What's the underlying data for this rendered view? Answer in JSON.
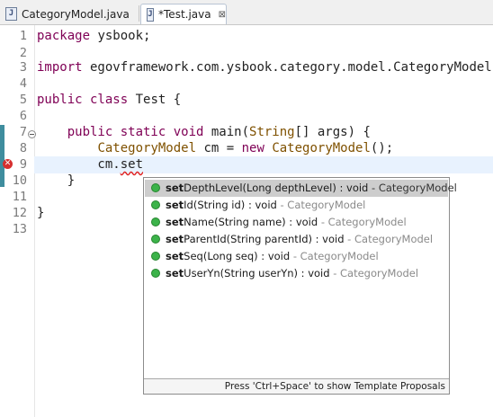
{
  "tabs": [
    {
      "label": "CategoryModel.java",
      "icon": "java-file-icon"
    },
    {
      "label": "*Test.java",
      "icon": "java-file-icon",
      "close": "⊠"
    }
  ],
  "editor": {
    "lines": [
      {
        "n": "1",
        "code": "package ysbook;"
      },
      {
        "n": "2",
        "code": ""
      },
      {
        "n": "3",
        "code": "import egovframework.com.ysbook.category.model.CategoryModel;"
      },
      {
        "n": "4",
        "code": ""
      },
      {
        "n": "5",
        "code": "public class Test {"
      },
      {
        "n": "6",
        "code": ""
      },
      {
        "n": "7",
        "code": "    public static void main(String[] args) {"
      },
      {
        "n": "8",
        "code": "        CategoryModel cm = new CategoryModel();"
      },
      {
        "n": "9",
        "code": "        cm.set"
      },
      {
        "n": "10",
        "code": "    }"
      },
      {
        "n": "11",
        "code": ""
      },
      {
        "n": "12",
        "code": "}"
      },
      {
        "n": "13",
        "code": ""
      }
    ]
  },
  "content_assist": {
    "proposals": [
      {
        "bold": "set",
        "rest": "DepthLevel(Long depthLevel) : void",
        "decl": " - CategoryModel"
      },
      {
        "bold": "set",
        "rest": "Id(String id) : void",
        "decl": " - CategoryModel"
      },
      {
        "bold": "set",
        "rest": "Name(String name) : void",
        "decl": " - CategoryModel"
      },
      {
        "bold": "set",
        "rest": "ParentId(String parentId) : void",
        "decl": " - CategoryModel"
      },
      {
        "bold": "set",
        "rest": "Seq(Long seq) : void",
        "decl": " - CategoryModel"
      },
      {
        "bold": "set",
        "rest": "UserYn(String userYn) : void",
        "decl": " - CategoryModel"
      }
    ],
    "selected_index": 0,
    "status": "Press 'Ctrl+Space' to show Template Proposals"
  },
  "colors": {
    "keyword": "#7f0055",
    "type": "#7f5100",
    "current_line": "#e8f2fe",
    "selection": "#cdcdcd"
  }
}
